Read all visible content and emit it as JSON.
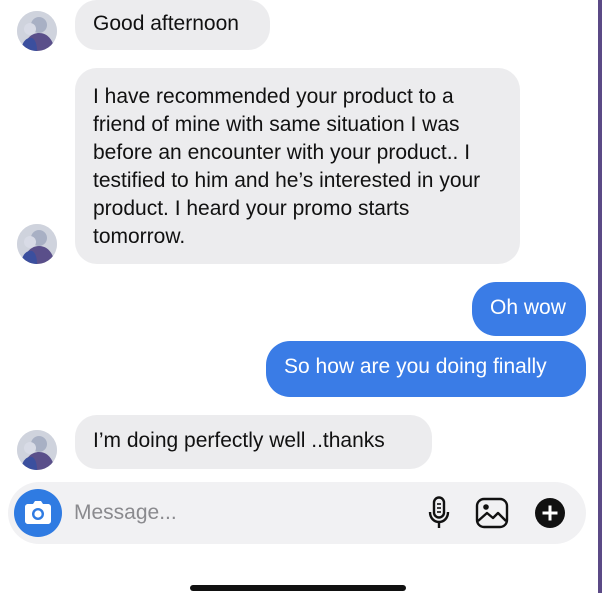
{
  "messages": [
    {
      "direction": "incoming",
      "text": "Good afternoon"
    },
    {
      "direction": "incoming",
      "text": "I have recommended your product to a friend of mine with same situation I was before an encounter with your product.. I testified to him and he’s interested in your product. I heard your promo starts tomorrow."
    },
    {
      "direction": "outgoing",
      "text": "Oh wow"
    },
    {
      "direction": "outgoing",
      "text": "So how are you doing finally"
    },
    {
      "direction": "incoming",
      "text": "I’m doing perfectly well ..thanks"
    }
  ],
  "composer": {
    "placeholder": "Message...",
    "value": ""
  },
  "icons": {
    "camera": "camera-icon",
    "mic": "microphone-icon",
    "gallery": "gallery-icon",
    "add": "plus-icon"
  },
  "colors": {
    "outgoing_bubble": "#3a7ce6",
    "incoming_bubble": "#ececee",
    "camera_button": "#2f7be2"
  }
}
